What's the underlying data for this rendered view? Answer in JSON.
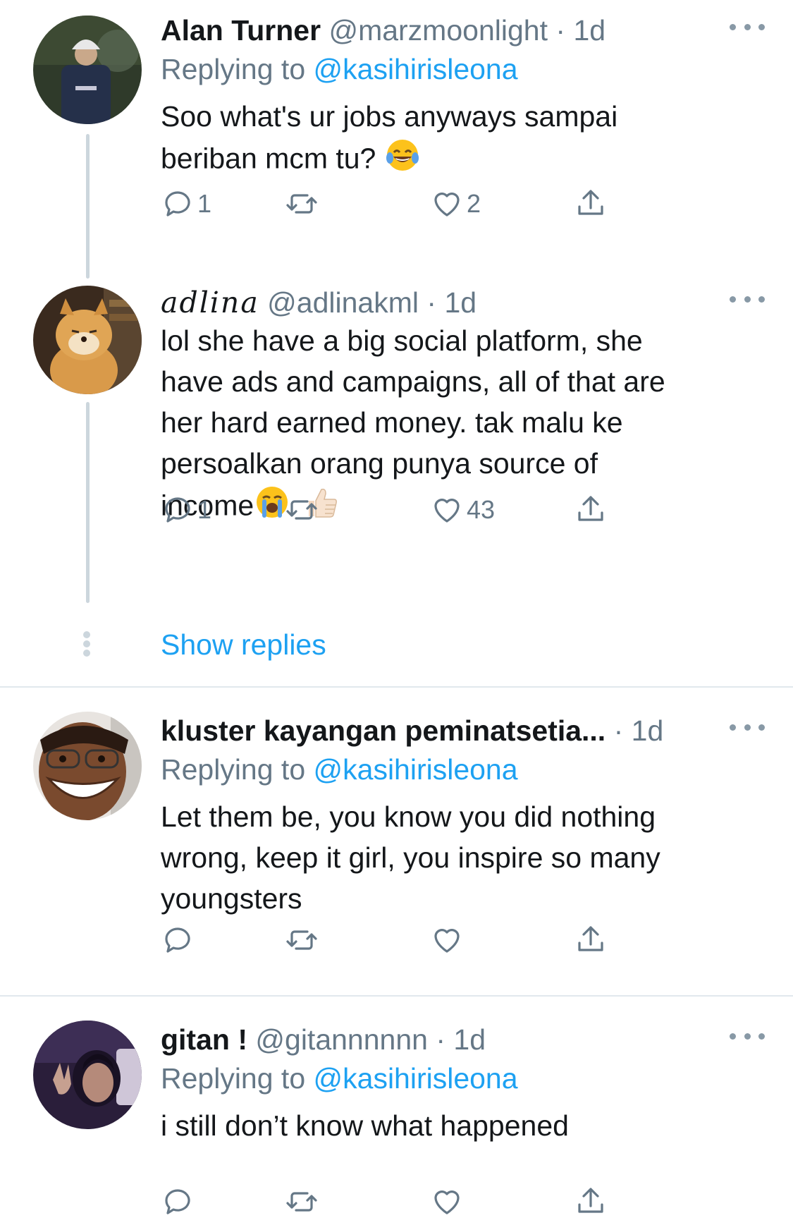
{
  "tweets": [
    {
      "name": "Alan Turner",
      "handle": "@marzmoonlight",
      "dot": "·",
      "time": "1d",
      "replying_prefix": "Replying to ",
      "replying_to": "@kasihirisleona",
      "text_line1": "Soo what's ur jobs anyways sampai",
      "text_line2": "beriban mcm tu?",
      "reply_count": "1",
      "retweet_count": "",
      "like_count": "2"
    },
    {
      "name": "adlina",
      "handle": "@adlinakml",
      "dot": "·",
      "time": "1d",
      "text_line1": "lol she have a big social platform, she",
      "text_line2": "have ads and campaigns, all of that are",
      "text_line3": "her hard earned money. tak malu ke",
      "text_line4": "persoalkan orang punya source of",
      "text_line5": "income",
      "reply_count": "1",
      "retweet_count": "",
      "like_count": "43"
    },
    {
      "name": "kluster kayangan peminatsetia...",
      "dot": "·",
      "time": "1d",
      "replying_prefix": "Replying to ",
      "replying_to": "@kasihirisleona",
      "text_line1": "Let them be, you know you did nothing",
      "text_line2": "wrong, keep it girl, you inspire so many",
      "text_line3": "youngsters",
      "reply_count": "",
      "retweet_count": "",
      "like_count": ""
    },
    {
      "name": "gitan !",
      "handle": "@gitannnnnn",
      "dot": "·",
      "time": "1d",
      "replying_prefix": "Replying to ",
      "replying_to": "@kasihirisleona",
      "text_line1": "i still don’t know what happened",
      "reply_count": "",
      "retweet_count": "",
      "like_count": ""
    }
  ],
  "show_replies_label": "Show replies",
  "colors": {
    "link": "#1da1f2",
    "secondary_text": "#657786",
    "primary_text": "#14171a",
    "thread_line": "#ccd6dd",
    "divider": "#e1e8ed"
  },
  "icons": [
    "reply-icon",
    "retweet-icon",
    "like-icon",
    "share-icon",
    "more-icon",
    "joy-emoji",
    "sob-emoji",
    "thumbs-up-emoji"
  ]
}
